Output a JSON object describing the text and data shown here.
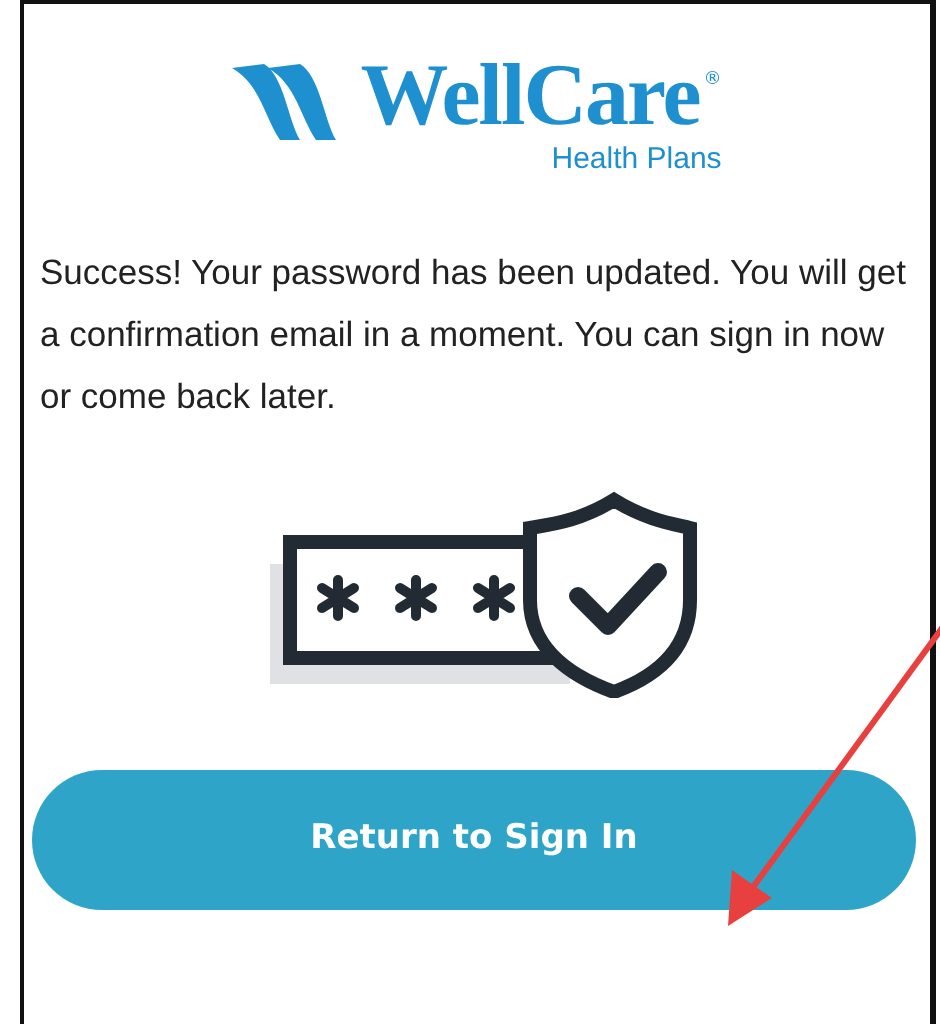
{
  "logo": {
    "name": "WellCare",
    "mark": "®",
    "tagline": "Health Plans"
  },
  "message": "Success! Your password has been updated. You will get a confirmation email in a moment. You can sign in now or come back later.",
  "button": {
    "label": "Return to Sign In"
  }
}
